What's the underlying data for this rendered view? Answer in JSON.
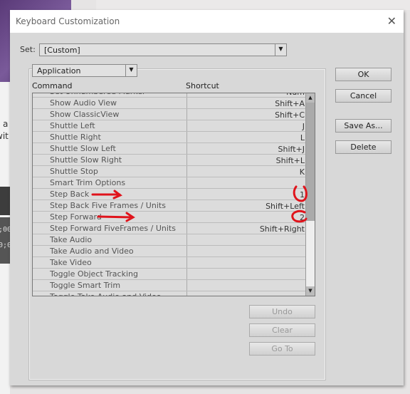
{
  "background": {
    "text_fragments": [
      "a",
      "wit",
      ";00",
      "0;0"
    ]
  },
  "dialog": {
    "title": "Keyboard Customization",
    "close_icon": "close-x",
    "set_label": "Set:",
    "set_value": "[Custom]",
    "category_value": "Application",
    "columns": {
      "command": "Command",
      "shortcut": "Shortcut"
    },
    "rows": [
      {
        "command": "Set Unnumbered Marker",
        "shortcut": "Num"
      },
      {
        "command": "Show Audio View",
        "shortcut": "Shift+A"
      },
      {
        "command": "Show ClassicView",
        "shortcut": "Shift+C"
      },
      {
        "command": "Shuttle Left",
        "shortcut": "J"
      },
      {
        "command": "Shuttle Right",
        "shortcut": "L"
      },
      {
        "command": "Shuttle Slow Left",
        "shortcut": "Shift+J"
      },
      {
        "command": "Shuttle Slow Right",
        "shortcut": "Shift+L"
      },
      {
        "command": "Shuttle Stop",
        "shortcut": "K"
      },
      {
        "command": "Smart Trim Options",
        "shortcut": ""
      },
      {
        "command": "Step Back",
        "shortcut": "1"
      },
      {
        "command": "Step Back Five Frames / Units",
        "shortcut": "Shift+Left"
      },
      {
        "command": "Step Forward",
        "shortcut": "2"
      },
      {
        "command": "Step Forward FiveFrames / Units",
        "shortcut": "Shift+Right"
      },
      {
        "command": "Take Audio",
        "shortcut": ""
      },
      {
        "command": "Take Audio and Video",
        "shortcut": ""
      },
      {
        "command": "Take Video",
        "shortcut": ""
      },
      {
        "command": "Toggle Object Tracking",
        "shortcut": ""
      },
      {
        "command": "Toggle Smart Trim",
        "shortcut": ""
      },
      {
        "command": "Toggle Take Audio and Video",
        "shortcut": ""
      }
    ],
    "buttons": {
      "ok": "OK",
      "cancel": "Cancel",
      "save_as": "Save As...",
      "delete": "Delete",
      "undo": "Undo",
      "clear": "Clear",
      "go_to": "Go To"
    },
    "annotation_color": "#e0141c"
  }
}
